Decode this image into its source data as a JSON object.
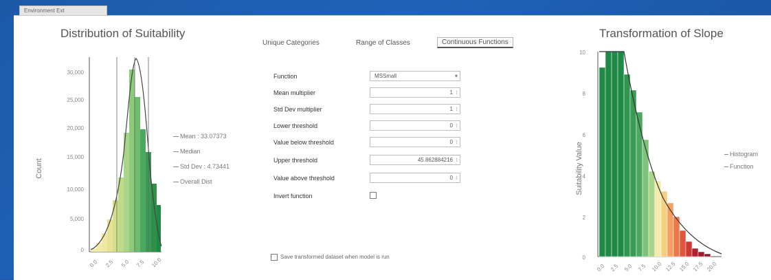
{
  "window_tab": "Environment Ext",
  "left_chart": {
    "title": "Distribution of Suitability",
    "ylabel": "Count",
    "yticks": [
      "30,000",
      "25,000",
      "20,000",
      "15,000",
      "10,000",
      "5,000",
      "0"
    ],
    "xticks": [
      "0.0",
      "2.5",
      "5.0",
      "7.5",
      "10.0"
    ],
    "legend": [
      "Mean : 33.07373",
      "Median",
      "Std Dev : 4.73441",
      "Overall Dist"
    ]
  },
  "tabs": [
    "Unique Categories",
    "Range of Classes",
    "Continuous Functions"
  ],
  "form": {
    "function_label": "Function",
    "function_value": "MSSmall",
    "mean_multiplier_label": "Mean multiplier",
    "mean_multiplier_value": "1",
    "stdev_multiplier_label": "Std Dev multiplier",
    "stdev_multiplier_value": "1",
    "lower_threshold_label": "Lower threshold",
    "lower_threshold_value": "0",
    "value_below_label": "Value below threshold",
    "value_below_value": "0",
    "upper_threshold_label": "Upper threshold",
    "upper_threshold_value": "45.862884216",
    "value_above_label": "Value above threshold",
    "value_above_value": "0",
    "invert_label": "Invert function",
    "save_label": "Save transformed dataset when model is run"
  },
  "right_chart": {
    "title": "Transformation of Slope",
    "ylabel": "Suitability Value",
    "yticks": [
      "10",
      "8",
      "6",
      "4",
      "2",
      "0"
    ],
    "xticks": [
      "0.0",
      "2.5",
      "5.0",
      "7.5",
      "10.0",
      "12.5",
      "15.0",
      "17.5",
      "20.0"
    ],
    "legend": [
      "Histogram",
      "Function"
    ]
  },
  "colors": {
    "dark_green": "#1f8a45",
    "green": "#4aa860",
    "light_green": "#a9d48a",
    "yellow": "#f2ebaa",
    "orange": "#f3a060",
    "red": "#e2553d",
    "dark_red": "#b02030"
  }
}
